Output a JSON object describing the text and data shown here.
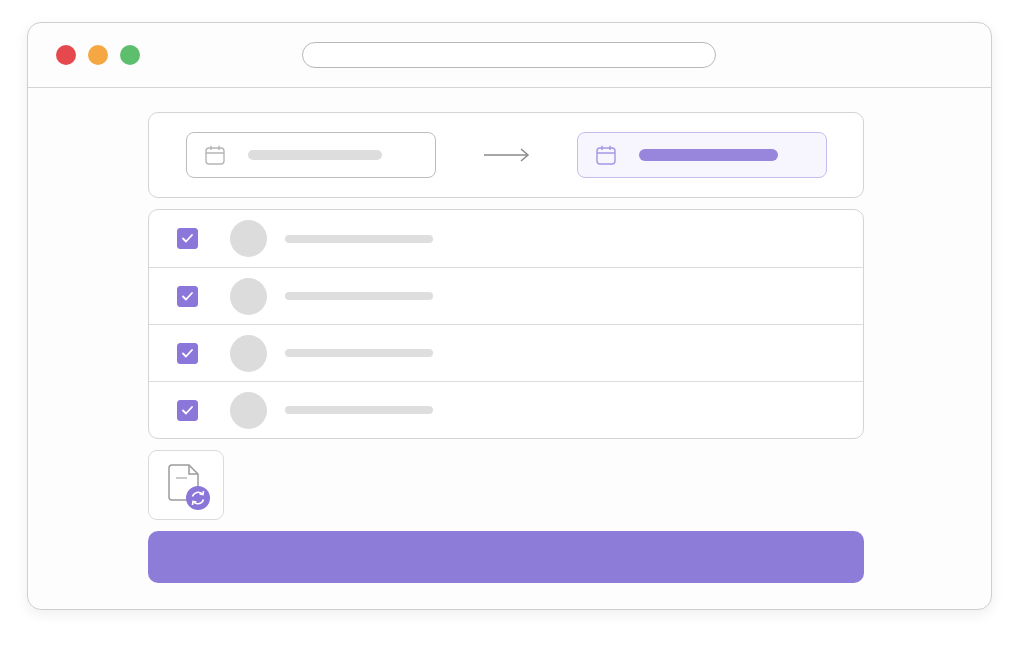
{
  "window": {
    "controls": [
      {
        "color": "#e5484d"
      },
      {
        "color": "#f5a742"
      },
      {
        "color": "#5dbf6e"
      }
    ]
  },
  "date_range": {
    "fields": [
      {
        "selected": false
      },
      {
        "selected": true
      }
    ]
  },
  "list": {
    "rows": [
      {
        "checked": true
      },
      {
        "checked": true
      },
      {
        "checked": true
      },
      {
        "checked": true
      }
    ]
  }
}
